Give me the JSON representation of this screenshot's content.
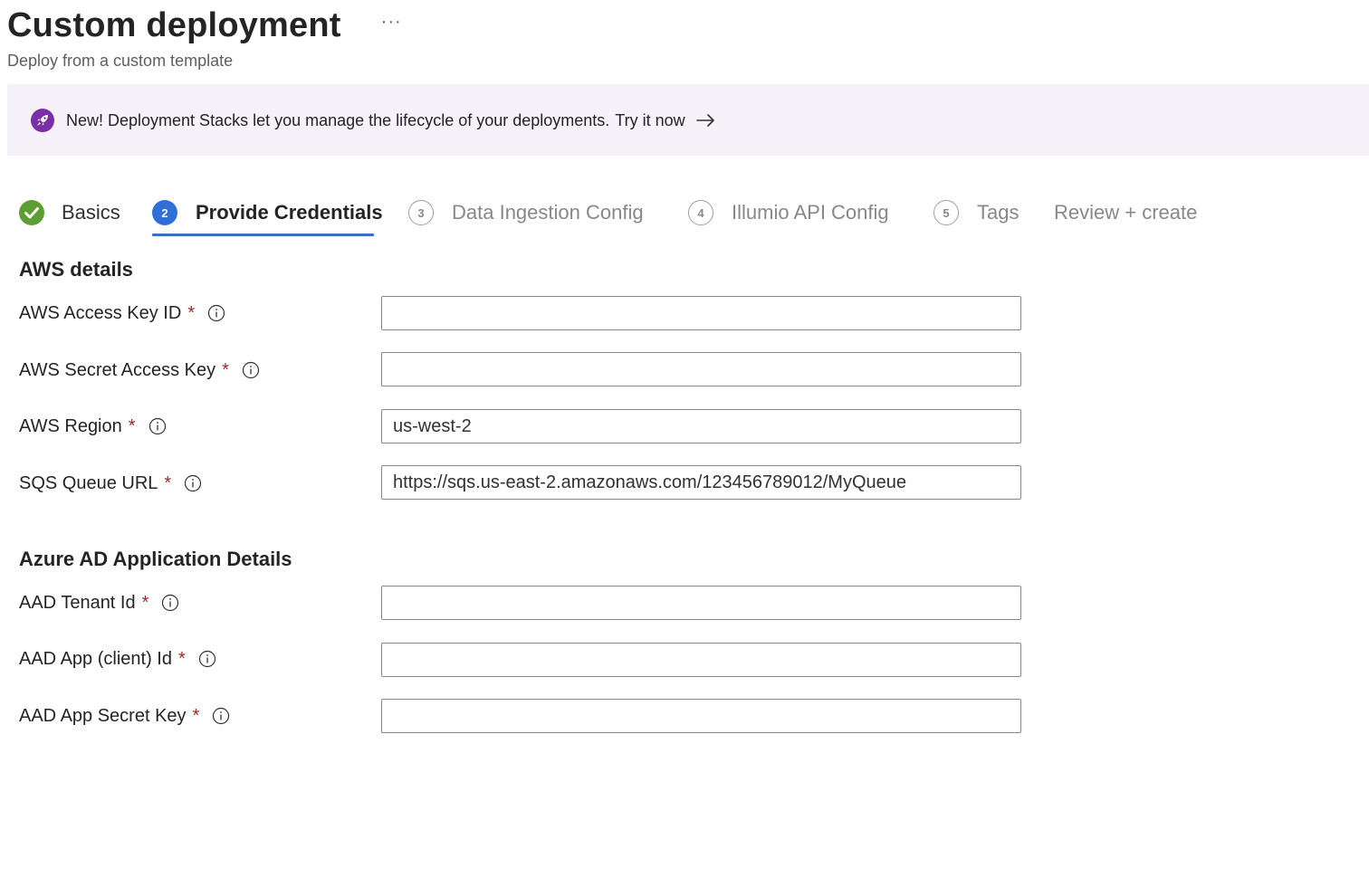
{
  "header": {
    "title": "Custom deployment",
    "more_label": "···",
    "subtitle": "Deploy from a custom template"
  },
  "banner": {
    "text": "New! Deployment Stacks let you manage the lifecycle of your deployments.",
    "link_text": "Try it now",
    "icon": "rocket-icon",
    "accent": "#7a2fa8"
  },
  "tabs": [
    {
      "label": "Basics",
      "state": "done"
    },
    {
      "label": "Provide Credentials",
      "number": "2",
      "state": "active"
    },
    {
      "label": "Data Ingestion Config",
      "number": "3",
      "state": "pending"
    },
    {
      "label": "Illumio API Config",
      "number": "4",
      "state": "pending"
    },
    {
      "label": "Tags",
      "number": "5",
      "state": "pending"
    },
    {
      "label": "Review + create",
      "state": "pending"
    }
  ],
  "aws": {
    "section_title": "AWS details",
    "fields": [
      {
        "label": "AWS Access Key ID",
        "value": ""
      },
      {
        "label": "AWS Secret Access Key",
        "value": ""
      },
      {
        "label": "AWS Region",
        "value": "us-west-2"
      },
      {
        "label": "SQS Queue URL",
        "value": "https://sqs.us-east-2.amazonaws.com/123456789012/MyQueue"
      }
    ]
  },
  "aad": {
    "section_title": "Azure AD Application Details",
    "fields": [
      {
        "label": "AAD Tenant Id",
        "value": ""
      },
      {
        "label": "AAD App (client) Id",
        "value": ""
      },
      {
        "label": "AAD App Secret Key",
        "value": ""
      }
    ]
  },
  "required_marker": "*",
  "colors": {
    "accent_blue": "#2f6fd6",
    "success_green": "#5c9e31",
    "required_red": "#a4262c",
    "banner_bg": "#f7f2f9"
  }
}
